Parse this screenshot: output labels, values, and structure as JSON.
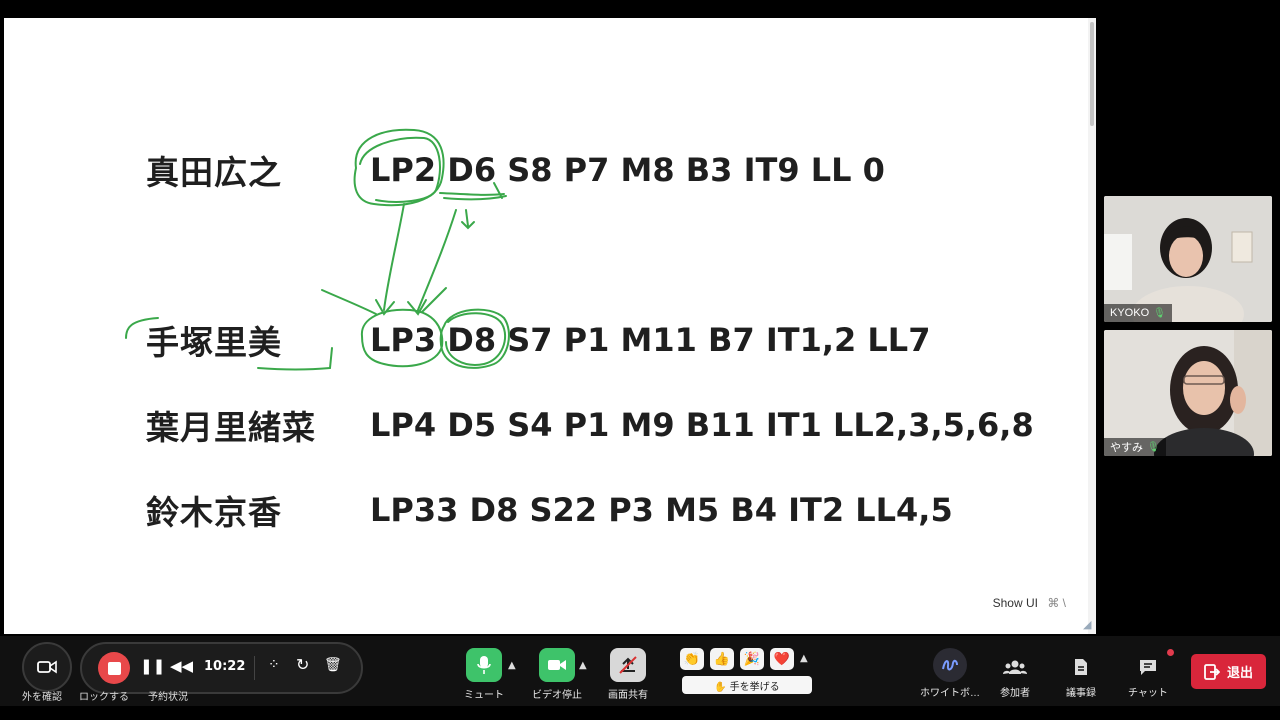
{
  "slide": {
    "rows": [
      {
        "name": "真田広之",
        "codes": "LP2 D6 S8 P7 M8 B3 IT9 LL 0"
      },
      {
        "name": "手塚里美",
        "codes": "LP3 D8 S7 P1 M11 B7 IT1,2 LL7"
      },
      {
        "name": "葉月里緒菜",
        "codes": "LP4 D5 S4 P1 M9 B11 IT1 LL2,3,5,6,8"
      },
      {
        "name": "鈴木京香",
        "codes": "LP33 D8 S22 P3 M5 B4 IT2 LL4,5"
      }
    ],
    "show_ui": "Show UI",
    "show_ui_shortcut": "⌘ \\",
    "annotation_color": "#3aa84a"
  },
  "participants": [
    {
      "name": "KYOKO"
    },
    {
      "name": "やすみ"
    }
  ],
  "toolbar": {
    "camera_label": "外を確認",
    "lock_label": "ロックする",
    "schedule_label": "予約状況",
    "record_time": "10:22",
    "mute_label": "ミュート",
    "video_label": "ビデオ停止",
    "share_label": "画面共有",
    "raise_hand_label": "✋ 手を挙げる",
    "whiteboard_label": "ホワイトボ…",
    "participants_label": "参加者",
    "minutes_label": "議事録",
    "chat_label": "チャット",
    "leave_label": "退出",
    "reactions": [
      "👏",
      "👍",
      "🎉",
      "❤️"
    ]
  },
  "colors": {
    "record_red": "#e8484a",
    "mic_green": "#3ec36a",
    "leave_red": "#d9263b"
  }
}
